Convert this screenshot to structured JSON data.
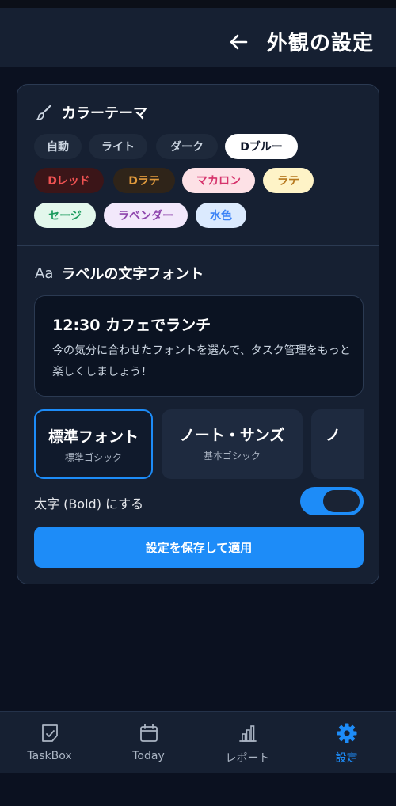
{
  "header": {
    "title": "外観の設定",
    "back_icon": "arrow-left-icon"
  },
  "color_theme": {
    "heading": "カラーテーマ",
    "icon": "paintbrush-icon",
    "selected": "Dブルー",
    "chips": [
      {
        "label": "自動",
        "bg": "#1e293b",
        "fg": "#cbd5e1"
      },
      {
        "label": "ライト",
        "bg": "#1e293b",
        "fg": "#cbd5e1"
      },
      {
        "label": "ダーク",
        "bg": "#1e293b",
        "fg": "#cbd5e1"
      },
      {
        "label": "Dブルー",
        "bg": "#ffffff",
        "fg": "#0f172a"
      },
      {
        "label": "Dレッド",
        "bg": "#3b1518",
        "fg": "#f05252"
      },
      {
        "label": "Dラテ",
        "bg": "#2f2419",
        "fg": "#e19a3c"
      },
      {
        "label": "マカロン",
        "bg": "#fde1e6",
        "fg": "#d6336c"
      },
      {
        "label": "ラテ",
        "bg": "#fef3c7",
        "fg": "#b7791f"
      },
      {
        "label": "セージ",
        "bg": "#e3f7ec",
        "fg": "#1a9b5c"
      },
      {
        "label": "ラベンダー",
        "bg": "#f2e8fb",
        "fg": "#8e44ad"
      },
      {
        "label": "水色",
        "bg": "#dbeafe",
        "fg": "#3b82f6"
      }
    ]
  },
  "label_font": {
    "heading": "ラベルの文字フォント",
    "icon": "text-aa-icon",
    "preview_title": "12:30 カフェでランチ",
    "preview_body": "今の気分に合わせたフォントを選んで、タスク管理をもっと楽しくしましょう！",
    "fonts": [
      {
        "name": "標準フォント",
        "sub": "標準ゴシック",
        "selected": true
      },
      {
        "name": "ノート・サンズ",
        "sub": "基本ゴシック",
        "selected": false
      },
      {
        "name": "ノ",
        "sub": "",
        "selected": false
      }
    ],
    "bold_label": "太字 (Bold) にする",
    "bold_enabled": true
  },
  "save_button": "設定を保存して適用",
  "tabs": [
    {
      "label": "TaskBox",
      "icon": "taskbox-icon",
      "active": false
    },
    {
      "label": "Today",
      "icon": "calendar-icon",
      "active": false
    },
    {
      "label": "レポート",
      "icon": "bar-chart-icon",
      "active": false
    },
    {
      "label": "設定",
      "icon": "gear-icon",
      "active": true
    }
  ],
  "colors": {
    "accent": "#1d8cf8",
    "background": "#0b1120",
    "card": "#162032"
  }
}
